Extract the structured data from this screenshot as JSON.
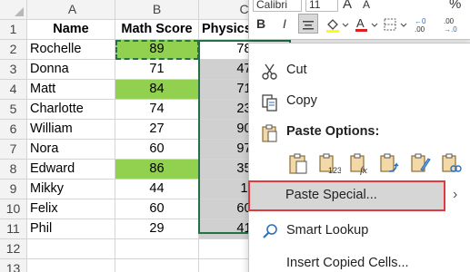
{
  "sheet": {
    "col_headers": [
      "A",
      "B",
      "C"
    ],
    "row_headers": [
      "1",
      "2",
      "3",
      "4",
      "5",
      "6",
      "7",
      "8",
      "9",
      "10",
      "11",
      "12",
      "13"
    ],
    "header_row": [
      "Name",
      "Math Score",
      "Physics"
    ],
    "rows": [
      {
        "name": "Rochelle",
        "math": "89",
        "physics": "78"
      },
      {
        "name": "Donna",
        "math": "71",
        "physics": "47"
      },
      {
        "name": "Matt",
        "math": "84",
        "physics": "71"
      },
      {
        "name": "Charlotte",
        "math": "74",
        "physics": "23"
      },
      {
        "name": "William",
        "math": "27",
        "physics": "90"
      },
      {
        "name": "Nora",
        "math": "60",
        "physics": "97"
      },
      {
        "name": "Edward",
        "math": "86",
        "physics": "35"
      },
      {
        "name": "Mikky",
        "math": "44",
        "physics": "1"
      },
      {
        "name": "Felix",
        "math": "60",
        "physics": "60"
      },
      {
        "name": "Phil",
        "math": "29",
        "physics": "41"
      }
    ],
    "colors": {
      "highlight_green": "#92d050",
      "selection_gray": "#d0d0d0",
      "selection_border": "#217346"
    }
  },
  "toolbar": {
    "font_name": "Calibri",
    "font_size": "11",
    "bold": "B",
    "italic": "I",
    "percent": "%",
    "grow_font": "A",
    "shrink_font": "A"
  },
  "context_menu": {
    "cut": "Cut",
    "copy": "Copy",
    "paste_options": "Paste Options:",
    "paste_special": "Paste Special...",
    "smart_lookup": "Smart Lookup",
    "insert_copied_cells": "Insert Copied Cells...",
    "highlight_color": "#e0393e",
    "icons": [
      "scissors-icon",
      "copy-icon",
      "clipboard-icon",
      "paste-icon",
      "paste-values-icon",
      "paste-formulas-icon",
      "paste-transpose-icon",
      "paste-formatting-icon",
      "paste-link-icon",
      "search-icon"
    ]
  }
}
